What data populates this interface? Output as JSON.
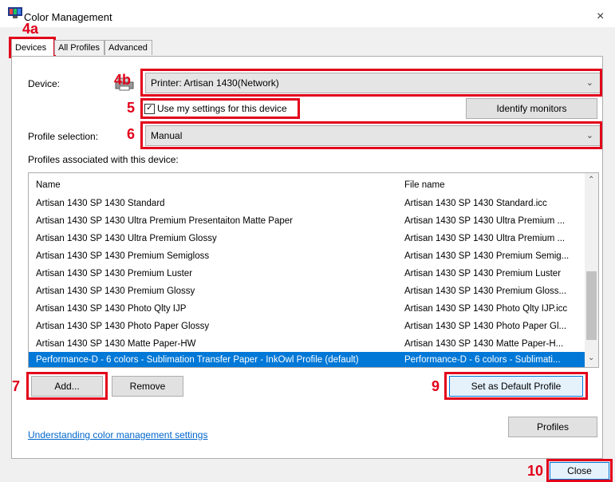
{
  "window": {
    "title": "Color Management",
    "close_glyph": "×"
  },
  "annotations": {
    "a4a": "4a",
    "a4b": "4b",
    "a5": "5",
    "a6": "6",
    "a7": "7",
    "a9": "9",
    "a10": "10"
  },
  "tabs": [
    {
      "label": "Devices",
      "active": true
    },
    {
      "label": "All Profiles",
      "active": false
    },
    {
      "label": "Advanced",
      "active": false
    }
  ],
  "device": {
    "label": "Device:",
    "value": "Printer: Artisan 1430(Network)"
  },
  "use_settings": {
    "label": "Use my settings for this device",
    "checked": true
  },
  "identify_button": "Identify monitors",
  "profile_selection": {
    "label": "Profile selection:",
    "value": "Manual"
  },
  "profiles_caption": "Profiles associated with this device:",
  "list": {
    "headers": [
      "Name",
      "File name"
    ],
    "rows": [
      [
        "Artisan 1430 SP 1430 Standard",
        "Artisan 1430 SP 1430 Standard.icc"
      ],
      [
        "Artisan 1430 SP 1430 Ultra Premium Presentaiton Matte Paper",
        "Artisan 1430 SP 1430 Ultra Premium ..."
      ],
      [
        "Artisan 1430 SP 1430 Ultra Premium Glossy",
        "Artisan 1430 SP 1430 Ultra Premium ..."
      ],
      [
        "Artisan 1430 SP 1430 Premium Semigloss",
        "Artisan 1430 SP 1430 Premium Semig..."
      ],
      [
        "Artisan 1430 SP 1430 Premium Luster",
        "Artisan 1430 SP 1430 Premium Luster"
      ],
      [
        "Artisan 1430 SP 1430 Premium Glossy",
        "Artisan 1430 SP 1430 Premium Gloss..."
      ],
      [
        "Artisan 1430 SP 1430 Photo Qlty IJP",
        "Artisan 1430 SP 1430 Photo Qlty IJP.icc"
      ],
      [
        "Artisan 1430 SP 1430 Photo Paper Glossy",
        "Artisan 1430 SP 1430 Photo Paper Gl..."
      ],
      [
        "Artisan 1430 SP 1430 Matte Paper-HW",
        "Artisan 1430 SP 1430 Matte Paper-H..."
      ],
      [
        "Performance-D - 6 colors - Sublimation Transfer Paper - InkOwl Profile (default)",
        "Performance-D - 6 colors - Sublimati..."
      ]
    ],
    "selected_index": 9
  },
  "buttons": {
    "add": "Add...",
    "remove": "Remove",
    "set_default": "Set as Default Profile",
    "profiles": "Profiles",
    "close": "Close"
  },
  "link": "Understanding color management settings",
  "colors": {
    "accent_red": "#e2001a",
    "selection": "#0078d7",
    "link": "#0066cc"
  }
}
